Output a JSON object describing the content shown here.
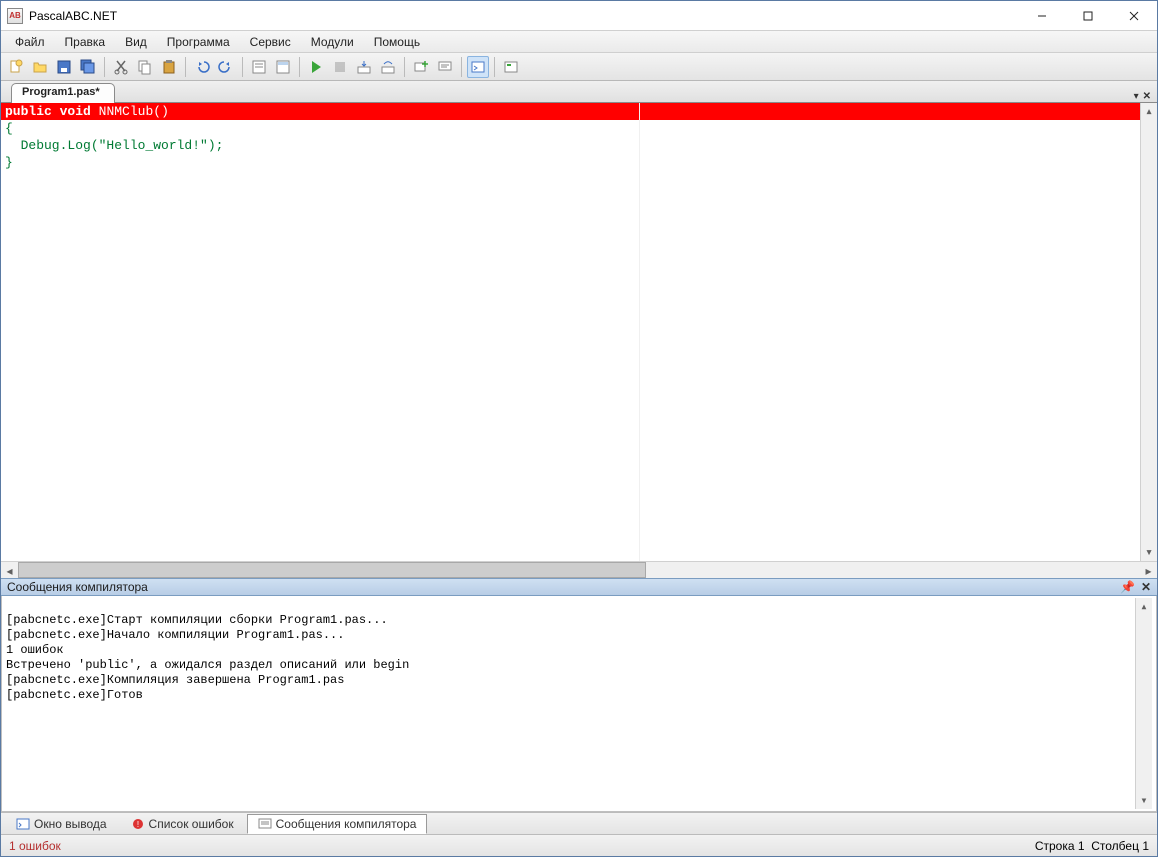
{
  "window": {
    "title": "PascalABC.NET"
  },
  "menu": {
    "file": "Файл",
    "edit": "Правка",
    "view": "Вид",
    "program": "Программа",
    "service": "Сервис",
    "modules": "Модули",
    "help": "Помощь"
  },
  "toolbar_icons": {
    "new": "new-file-icon",
    "open": "open-folder-icon",
    "save": "save-icon",
    "save_all": "save-all-icon",
    "cut": "cut-icon",
    "copy": "copy-icon",
    "paste": "paste-icon",
    "undo": "undo-icon",
    "redo": "redo-icon",
    "print": "properties-icon",
    "find": "find-icon",
    "run": "run-icon",
    "stop": "stop-icon",
    "step_into": "step-into-icon",
    "step_over": "step-over-icon",
    "add_watch": "add-watch-icon",
    "comment": "comment-icon",
    "output_win": "output-window-icon",
    "module": "module-icon"
  },
  "tabs": {
    "active": "Program1.pas*"
  },
  "code": {
    "line1_kw1": "public",
    "line1_kw2": "void",
    "line1_ident": "NNMClub",
    "line1_paren": "()",
    "line2": "{",
    "line3": "  Debug.Log(\"Hello_world!\");",
    "line4": "}"
  },
  "compiler_panel": {
    "title": "Сообщения компилятора",
    "lines": {
      "l1": "[pabcnetc.exe]Старт компиляции сборки Program1.pas...",
      "l2": "[pabcnetc.exe]Начало компиляции Program1.pas...",
      "l3": "1 ошибок",
      "l4": "Встречено 'public', а ожидался раздел описаний или begin",
      "l5": "[pabcnetc.exe]Компиляция завершена Program1.pas",
      "l6": "[pabcnetc.exe]Готов"
    }
  },
  "bottom_tabs": {
    "output": "Окно вывода",
    "errors": "Список ошибок",
    "compiler": "Сообщения компилятора"
  },
  "status": {
    "left": "1 ошибок",
    "right_line_label": "Строка",
    "right_line_val": "1",
    "right_col_label": "Столбец",
    "right_col_val": "1"
  }
}
